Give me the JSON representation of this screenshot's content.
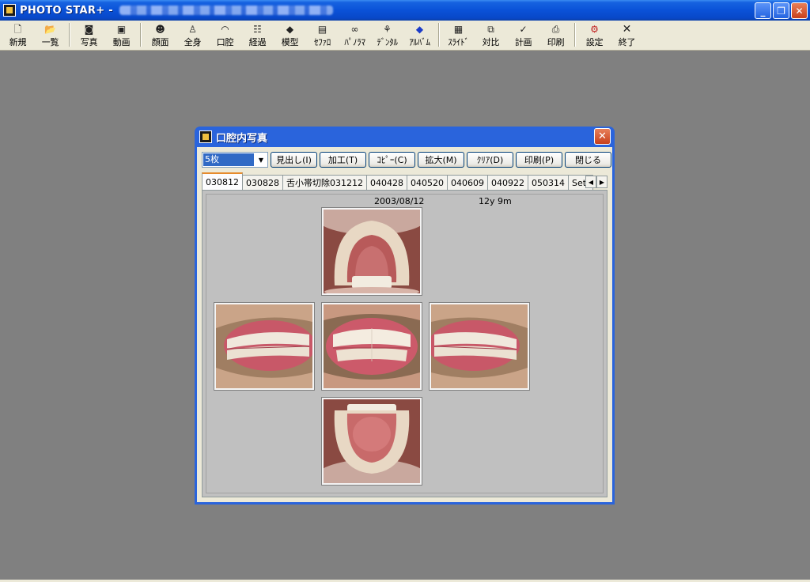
{
  "app": {
    "title": "PHOTO STAR+ -"
  },
  "toolbar": {
    "items": [
      {
        "label": "新規",
        "icon": "new-document-icon"
      },
      {
        "label": "一覧",
        "icon": "open-folder-icon"
      },
      {
        "label": "写真",
        "icon": "camera-icon"
      },
      {
        "label": "動画",
        "icon": "video-camera-icon"
      },
      {
        "label": "顔面",
        "icon": "face-icon"
      },
      {
        "label": "全身",
        "icon": "walking-person-icon"
      },
      {
        "label": "口腔",
        "icon": "mouth-icon"
      },
      {
        "label": "経過",
        "icon": "progress-grid-icon"
      },
      {
        "label": "模型",
        "icon": "model-icon"
      },
      {
        "label": "ｾﾌｧﾛ",
        "icon": "cephalo-icon"
      },
      {
        "label": "ﾊﾟﾉﾗﾏ",
        "icon": "binoculars-icon"
      },
      {
        "label": "ﾃﾞﾝﾀﾙ",
        "icon": "dental-tree-icon"
      },
      {
        "label": "ｱﾙﾊﾞﾑ",
        "icon": "album-icon"
      },
      {
        "label": "ｽﾗｲﾄﾞ",
        "icon": "slide-projector-icon"
      },
      {
        "label": "対比",
        "icon": "compare-icon"
      },
      {
        "label": "計画",
        "icon": "plan-check-icon"
      },
      {
        "label": "印刷",
        "icon": "printer-icon"
      },
      {
        "label": "設定",
        "icon": "settings-icon"
      },
      {
        "label": "終了",
        "icon": "exit-x-icon"
      }
    ]
  },
  "dialog": {
    "title": "口腔内写真",
    "combo_value": "5枚",
    "buttons": [
      "見出し(I)",
      "加工(T)",
      "ｺﾋﾟｰ(C)",
      "拡大(M)",
      "ｸﾘｱ(D)",
      "印刷(P)",
      "閉じる"
    ],
    "tabs": [
      "030812",
      "030828",
      "舌小帯切除031212",
      "040428",
      "040520",
      "040609",
      "040922",
      "050314",
      "Set!"
    ],
    "active_tab": 0,
    "date": "2003/08/12",
    "age": "12y 9m"
  }
}
